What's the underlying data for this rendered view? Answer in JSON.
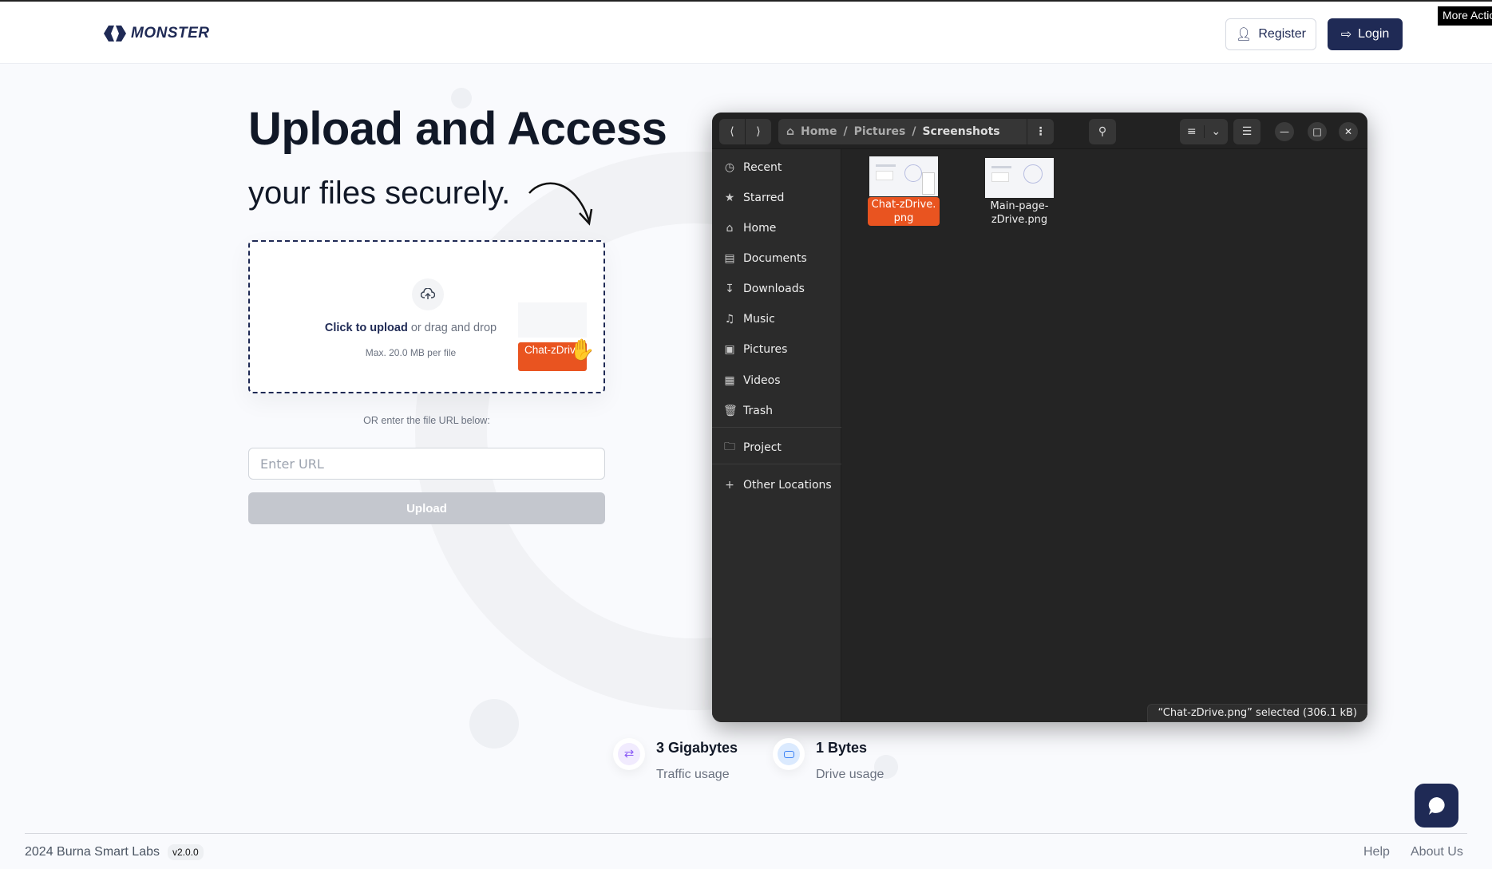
{
  "header": {
    "logo": "MONSTER",
    "register": "Register",
    "login": "Login",
    "tooltip": "More Actions"
  },
  "hero": {
    "title": "Upload and Access",
    "subtitle": "your files securely."
  },
  "upload": {
    "click": "Click to upload",
    "drag": " or drag and drop",
    "max": "Max. 20.0 MB per file",
    "drag_file_label": "Chat-zDrive.png",
    "or": "OR enter the file URL below:",
    "url_placeholder": "Enter URL",
    "button": "Upload"
  },
  "file_manager": {
    "breadcrumb": [
      "Home",
      "Pictures",
      "Screenshots"
    ],
    "sidebar": [
      {
        "label": "Recent",
        "icon": "clock-icon"
      },
      {
        "label": "Starred",
        "icon": "star-icon"
      },
      {
        "label": "Home",
        "icon": "home-icon"
      },
      {
        "label": "Documents",
        "icon": "document-icon"
      },
      {
        "label": "Downloads",
        "icon": "download-icon"
      },
      {
        "label": "Music",
        "icon": "music-icon"
      },
      {
        "label": "Pictures",
        "icon": "image-icon"
      },
      {
        "label": "Videos",
        "icon": "film-icon"
      },
      {
        "label": "Trash",
        "icon": "trash-icon"
      },
      {
        "label": "Project",
        "icon": "folder-icon"
      },
      {
        "label": "Other Locations",
        "icon": "plus-icon"
      }
    ],
    "files": [
      {
        "line1": "Chat-zDrive.",
        "line2": "png",
        "selected": true
      },
      {
        "line1": "Main-page-",
        "line2": "zDrive.png",
        "selected": false
      }
    ],
    "status": "“Chat-zDrive.png” selected  (306.1 kB)",
    "accent": "#e95420"
  },
  "stats": [
    {
      "value": "3 Gigabytes",
      "label": "Traffic usage",
      "color": "#8b5cf6"
    },
    {
      "value": "1 Bytes",
      "label": "Drive usage",
      "color": "#3b82f6"
    }
  ],
  "footer": {
    "copyright": "2024 Burna Smart Labs",
    "version": "v2.0.0",
    "help": "Help",
    "about": "About Us"
  },
  "colors": {
    "brand": "#1f2a55"
  }
}
